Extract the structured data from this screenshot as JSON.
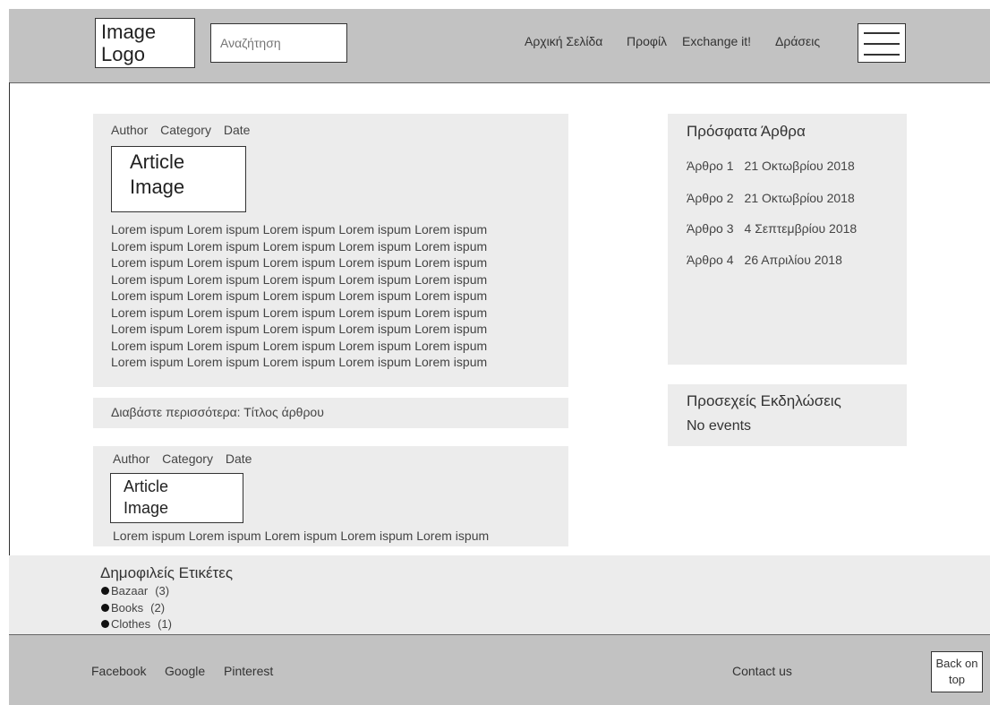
{
  "header": {
    "logo_text": "Image Logo",
    "logo_line1": "Image",
    "logo_line2": "Logo",
    "search_placeholder": "Αναζήτηση",
    "nav": [
      "Αρχική Σελίδα",
      "Προφίλ",
      "Exchange it!",
      "Δράσεις"
    ],
    "menu_icon": "hamburger-menu-icon"
  },
  "articles": [
    {
      "meta": {
        "author": "Author",
        "category": "Category",
        "date": "Date"
      },
      "image_line1": "Article",
      "image_line2": "Image",
      "lines": [
        "Lorem ispum Lorem ispum Lorem ispum Lorem ispum Lorem ispum",
        "Lorem ispum Lorem ispum Lorem ispum Lorem ispum Lorem ispum",
        "Lorem ispum Lorem ispum Lorem ispum Lorem ispum Lorem ispum",
        "Lorem ispum Lorem ispum Lorem ispum Lorem ispum Lorem ispum",
        "Lorem ispum Lorem ispum Lorem ispum Lorem ispum Lorem ispum",
        "Lorem ispum Lorem ispum Lorem ispum Lorem ispum Lorem ispum",
        "Lorem ispum Lorem ispum Lorem ispum Lorem ispum Lorem ispum",
        "Lorem ispum Lorem ispum Lorem ispum Lorem ispum Lorem ispum",
        "Lorem ispum Lorem ispum Lorem ispum Lorem ispum Lorem ispum"
      ]
    },
    {
      "meta": {
        "author": "Author",
        "category": "Category",
        "date": "Date"
      },
      "image_line1": "Article",
      "image_line2": "Image",
      "lines": [
        "Lorem ispum Lorem ispum Lorem ispum Lorem ispum Lorem ispum"
      ]
    }
  ],
  "read_more": "Διαβάστε περισσότερα: Τίτλος άρθρου",
  "sidebar": {
    "recent_title": "Πρόσφατα Άρθρα",
    "recent": [
      {
        "label": "Άρθρο 1",
        "date": "21 Οκτωβρίου 2018"
      },
      {
        "label": "Άρθρο 2",
        "date": "21 Οκτωβρίου 2018"
      },
      {
        "label": "Άρθρο 3",
        "date": "4 Σεπτεμβρίου 2018"
      },
      {
        "label": "Άρθρο 4",
        "date": "26 Απριλίου 2018"
      }
    ],
    "events_title": "Προσεχείς Εκδηλώσεις",
    "events_empty": "No events"
  },
  "tags": {
    "title": "Δημοφιλείς Ετικέτες",
    "items": [
      {
        "name": "Bazaar",
        "count": "(3)"
      },
      {
        "name": "Books",
        "count": "(2)"
      },
      {
        "name": "Clothes",
        "count": "(1)"
      }
    ]
  },
  "footer": {
    "links": [
      "Facebook",
      "Google",
      "Pinterest"
    ],
    "contact": "Contact us",
    "back_to_top_line1": "Back on",
    "back_to_top_line2": "top"
  }
}
